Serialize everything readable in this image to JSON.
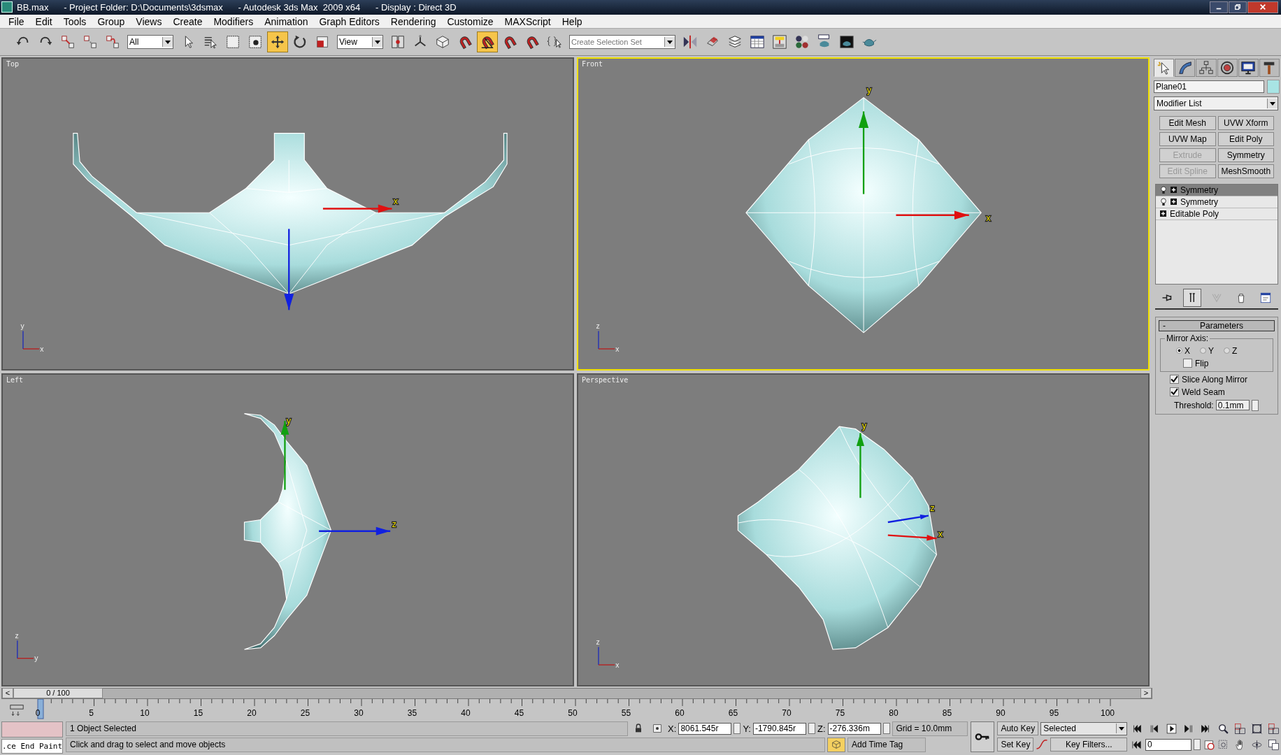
{
  "window": {
    "title": "BB.max      - Project Folder: D:\\Documents\\3dsmax      - Autodesk 3ds Max  2009 x64      - Display : Direct 3D"
  },
  "menu": [
    "File",
    "Edit",
    "Tools",
    "Group",
    "Views",
    "Create",
    "Modifiers",
    "Animation",
    "Graph Editors",
    "Rendering",
    "Customize",
    "MAXScript",
    "Help"
  ],
  "toolbar": [
    {
      "kind": "button",
      "selected": false
    },
    {
      "kind": "button",
      "selected": false
    },
    {
      "kind": "button",
      "selected": false
    },
    {
      "kind": "button",
      "selected": false
    },
    {
      "kind": "button",
      "selected": false
    },
    {
      "kind": "dropdown",
      "value": "All"
    },
    {
      "kind": "button",
      "selected": false
    },
    {
      "kind": "button",
      "selected": false
    },
    {
      "kind": "button",
      "selected": false
    },
    {
      "kind": "button",
      "selected": false
    },
    {
      "kind": "button",
      "selected": true
    },
    {
      "kind": "button",
      "selected": false
    },
    {
      "kind": "button",
      "selected": false
    },
    {
      "kind": "dropdown",
      "value": "View"
    },
    {
      "kind": "button",
      "selected": false
    },
    {
      "kind": "button",
      "selected": false
    },
    {
      "kind": "button",
      "selected": false
    },
    {
      "kind": "button",
      "selected": false
    },
    {
      "kind": "button",
      "selected": true
    },
    {
      "kind": "button",
      "selected": false
    },
    {
      "kind": "button",
      "selected": false
    },
    {
      "kind": "button",
      "selected": false
    },
    {
      "kind": "dropdown",
      "placeholder": "Create Selection Set"
    },
    {
      "kind": "button",
      "selected": false
    },
    {
      "kind": "button",
      "selected": false
    },
    {
      "kind": "button",
      "selected": false
    },
    {
      "kind": "button",
      "selected": false
    },
    {
      "kind": "button",
      "selected": false
    },
    {
      "kind": "button",
      "selected": false
    },
    {
      "kind": "button",
      "selected": false
    },
    {
      "kind": "button",
      "selected": false
    },
    {
      "kind": "button",
      "selected": false
    }
  ],
  "viewports": [
    {
      "label": "Top",
      "active": false,
      "tripod": [
        "y",
        "x"
      ],
      "gizmo": [
        "x"
      ]
    },
    {
      "label": "Front",
      "active": true,
      "tripod": [
        "z",
        "x"
      ],
      "gizmo": [
        "y",
        "x"
      ]
    },
    {
      "label": "Left",
      "active": false,
      "tripod": [
        "z",
        "y"
      ],
      "gizmo": [
        "y",
        "z"
      ]
    },
    {
      "label": "Perspective",
      "active": false,
      "tripod": [
        "z",
        "x"
      ],
      "gizmo": [
        "y",
        "z",
        "x"
      ]
    }
  ],
  "command_panel": {
    "tabs": [
      {
        "selected": true
      },
      {
        "selected": false
      },
      {
        "selected": false
      },
      {
        "selected": false
      },
      {
        "selected": false
      },
      {
        "selected": false
      }
    ],
    "object_name": "Plane01",
    "modifier_list": "Modifier List",
    "modifier_buttons": [
      {
        "label": "Edit Mesh",
        "disabled": false
      },
      {
        "label": "UVW Xform",
        "disabled": false
      },
      {
        "label": "UVW Map",
        "disabled": false
      },
      {
        "label": "Edit Poly",
        "disabled": false
      },
      {
        "label": "Extrude",
        "disabled": true
      },
      {
        "label": "Symmetry",
        "disabled": false
      },
      {
        "label": "Edit Spline",
        "disabled": true
      },
      {
        "label": "MeshSmooth",
        "disabled": false
      }
    ],
    "stack": [
      {
        "label": "Symmetry",
        "kind": "modifier",
        "selected": true
      },
      {
        "label": "Symmetry",
        "kind": "modifier",
        "selected": false
      },
      {
        "label": "Editable Poly",
        "kind": "base",
        "selected": false
      }
    ],
    "stack_tools": [
      {
        "on": false
      },
      {
        "on": true
      },
      {
        "on": false
      },
      {
        "on": false
      },
      {
        "on": false
      }
    ],
    "rollout": {
      "collapse": "-",
      "title": "Parameters",
      "group": "Mirror Axis:",
      "axes": [
        {
          "label": "X",
          "selected": true
        },
        {
          "label": "Y",
          "selected": false
        },
        {
          "label": "Z",
          "selected": false
        }
      ],
      "flip": {
        "label": "Flip",
        "checked": false
      },
      "options": [
        {
          "label": "Slice Along Mirror",
          "checked": true
        },
        {
          "label": "Weld Seam",
          "checked": true
        }
      ],
      "threshold": {
        "label": "Threshold:",
        "value": "0.1mm"
      }
    }
  },
  "time_slider": {
    "prev": "<",
    "label": "0 / 100",
    "next": ">",
    "level": 0
  },
  "ruler": {
    "labels": [
      "0",
      "5",
      "10",
      "15",
      "20",
      "25",
      "30",
      "35",
      "40",
      "45",
      "50",
      "55",
      "60",
      "65",
      "70",
      "75",
      "80",
      "85",
      "90",
      "95",
      "100"
    ]
  },
  "listener": {
    "output": ".ce End Paint"
  },
  "status": {
    "selection": "1 Object Selected",
    "prompt": "Click and drag to select and move objects",
    "coords": [
      {
        "axis": "X:",
        "value": "8061.545r"
      },
      {
        "axis": "Y:",
        "value": "-1790.845r"
      },
      {
        "axis": "Z:",
        "value": "-276.336m"
      }
    ],
    "grid": "Grid = 10.0mm",
    "time_tag": "Add Time Tag"
  },
  "animation": {
    "auto_key": {
      "label": "Auto Key",
      "on": false
    },
    "set_key": "Set Key",
    "key_mode": "Selected",
    "key_filters": "Key Filters...",
    "frame": "0"
  }
}
